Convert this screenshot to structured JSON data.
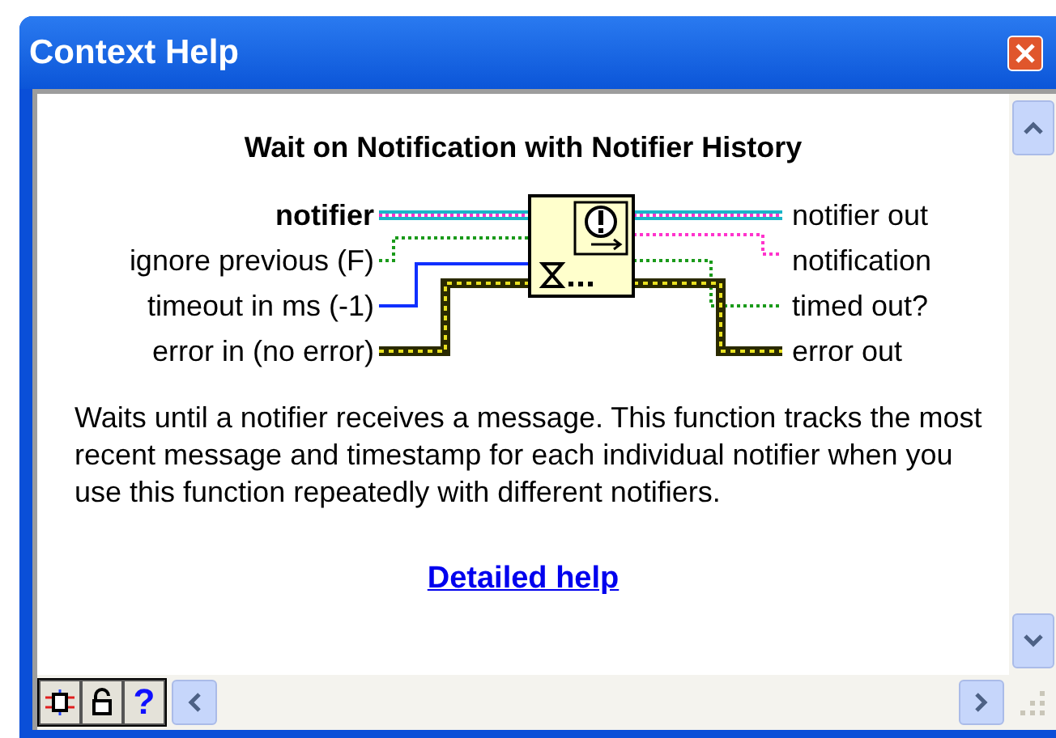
{
  "window": {
    "title": "Context Help"
  },
  "heading": "Wait on Notification with Notifier History",
  "inputs": [
    {
      "label": "notifier",
      "required": true,
      "kind": "refnum"
    },
    {
      "label": "ignore previous (F)",
      "required": false,
      "kind": "boolean"
    },
    {
      "label": "timeout in ms (-1)",
      "required": false,
      "kind": "numeric"
    },
    {
      "label": "error in (no error)",
      "required": false,
      "kind": "error"
    }
  ],
  "outputs": [
    {
      "label": "notifier out",
      "kind": "refnum"
    },
    {
      "label": "notification",
      "kind": "variant"
    },
    {
      "label": "timed out?",
      "kind": "boolean"
    },
    {
      "label": "error out",
      "kind": "error"
    }
  ],
  "description": "Waits until a notifier receives a message. This function tracks the most recent message and timestamp for each individual notifier when you use this function repeatedly with different notifiers.",
  "link": "Detailed help",
  "toolbar": [
    {
      "kind": "diagram"
    },
    {
      "kind": "lock"
    },
    {
      "kind": "help",
      "label": "?"
    }
  ]
}
